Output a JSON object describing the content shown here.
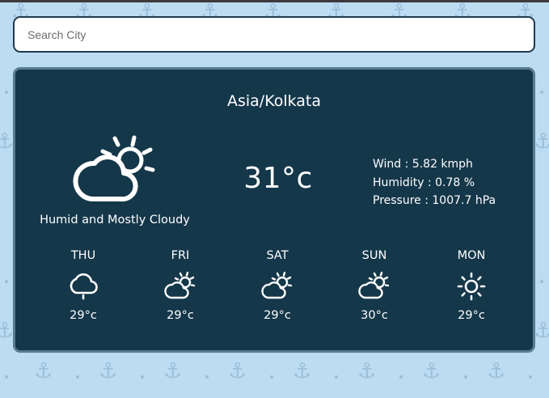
{
  "search": {
    "placeholder": "Search City",
    "value": ""
  },
  "location": "Asia/Kolkata",
  "current": {
    "icon": "cloud-sun-icon",
    "condition": "Humid and Mostly Cloudy",
    "temperature": "31°c",
    "wind": "Wind : 5.82 kmph",
    "humidity": "Humidity : 0.78 %",
    "pressure": "Pressure : 1007.7 hPa"
  },
  "forecast": [
    {
      "day": "THU",
      "icon": "cloud-drizzle-icon",
      "temp": "29°c"
    },
    {
      "day": "FRI",
      "icon": "cloud-sun-icon",
      "temp": "29°c"
    },
    {
      "day": "SAT",
      "icon": "cloud-sun-icon",
      "temp": "29°c"
    },
    {
      "day": "SUN",
      "icon": "cloud-sun-icon",
      "temp": "30°c"
    },
    {
      "day": "MON",
      "icon": "sun-icon",
      "temp": "29°c"
    }
  ],
  "colors": {
    "background": "#bcdcf2",
    "card": "#15374a",
    "card_border": "#5a7c91",
    "search_border": "#1e3a4f",
    "pattern": "#9bbfd8",
    "text": "#ffffff"
  }
}
